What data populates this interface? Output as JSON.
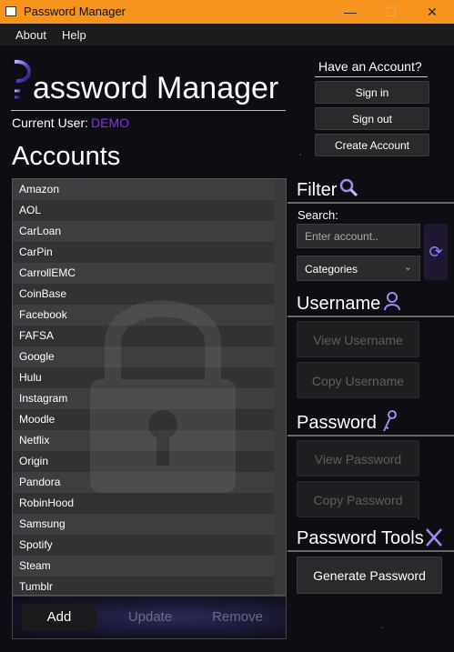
{
  "window": {
    "title": "Password Manager"
  },
  "menu": {
    "items": [
      "About",
      "Help"
    ]
  },
  "header": {
    "app_title": "assword Manager",
    "current_user_label": "Current User:",
    "current_user_value": "DEMO"
  },
  "account_box": {
    "title": "Have an Account?",
    "sign_in": "Sign in",
    "sign_out": "Sign out",
    "create": "Create Account"
  },
  "accounts": {
    "title": "Accounts",
    "items": [
      "Amazon",
      "AOL",
      "CarLoan",
      "CarPin",
      "CarrollEMC",
      "CoinBase",
      "Facebook",
      "FAFSA",
      "Google",
      "Hulu",
      "Instagram",
      "Moodle",
      "Netflix",
      "Origin",
      "Pandora",
      "RobinHood",
      "Samsung",
      "Spotify",
      "Steam",
      "Tumblr"
    ]
  },
  "account_actions": {
    "add": "Add",
    "update": "Update",
    "remove": "Remove"
  },
  "filter": {
    "title": "Filter",
    "search_label": "Search:",
    "search_placeholder": "Enter account..",
    "category_selected": "Categories"
  },
  "username_section": {
    "title": "Username",
    "view": "View Username",
    "copy": "Copy Username"
  },
  "password_section": {
    "title": "Password",
    "view": "View Password",
    "copy": "Copy Password"
  },
  "tools_section": {
    "title": "Password Tools",
    "generate": "Generate Password"
  },
  "colors": {
    "titlebar": "#f7941d",
    "accent": "#8a2be2",
    "background": "#0d0d14"
  },
  "icons": [
    "app-window-icon",
    "minimize-icon",
    "maximize-icon",
    "close-icon",
    "key-p-logo-icon",
    "magnifier-icon",
    "refresh-icon",
    "user-icon",
    "key-icon",
    "tools-icon",
    "lock-watermark-icon"
  ]
}
